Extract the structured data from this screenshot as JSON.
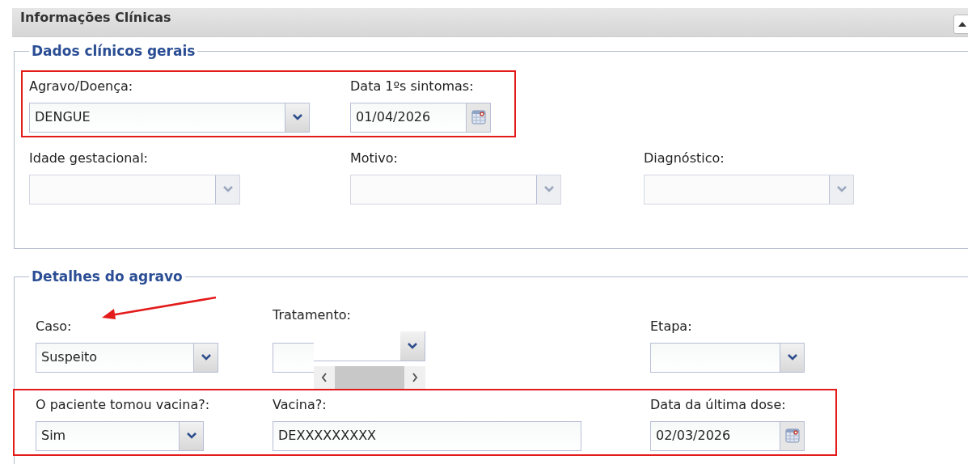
{
  "panel": {
    "title": "Informações Clínicas",
    "collapsed": false
  },
  "sections": [
    {
      "legend": "Dados clínicos gerais",
      "rows": [
        {
          "highlighted": true,
          "fields": [
            {
              "kind": "select",
              "label": "Agravo/Doença:",
              "value": "DENGUE",
              "disabled": false,
              "annotated": false,
              "popup_open": false
            },
            {
              "kind": "date",
              "label": "Data 1ºs sintomas:",
              "value": "01/04/2026"
            }
          ]
        },
        {
          "highlighted": false,
          "fields": [
            {
              "kind": "select",
              "label": "Idade gestacional:",
              "disabled": true,
              "annotated": false,
              "popup_open": false
            },
            {
              "kind": "select",
              "label": "Motivo:",
              "disabled": true,
              "annotated": false,
              "popup_open": false
            },
            {
              "kind": "select",
              "label": "Diagnóstico:",
              "disabled": true,
              "annotated": false,
              "popup_open": false
            }
          ]
        }
      ]
    },
    {
      "legend": "Detalhes do agravo",
      "rows": [
        {
          "highlighted": false,
          "fields": [
            {
              "kind": "select",
              "label": "Caso:",
              "value": "Suspeito",
              "disabled": false,
              "annotated": true,
              "popup_open": false
            },
            {
              "kind": "select",
              "label": "Tratamento:",
              "disabled": false,
              "annotated": false,
              "popup_open": true
            },
            {
              "kind": "select",
              "label": "Etapa:",
              "disabled": false,
              "annotated": false,
              "popup_open": false
            }
          ]
        },
        {
          "highlighted": true,
          "fields": [
            {
              "kind": "select",
              "label": "O paciente tomou vacina?:",
              "value": "Sim",
              "disabled": false,
              "annotated": false,
              "popup_open": false
            },
            {
              "kind": "text",
              "label": "Vacina?:",
              "value": "DEXXXXXXXXX"
            },
            {
              "kind": "date",
              "label": "Data da última dose:",
              "value": "02/03/2026"
            }
          ]
        }
      ]
    }
  ]
}
